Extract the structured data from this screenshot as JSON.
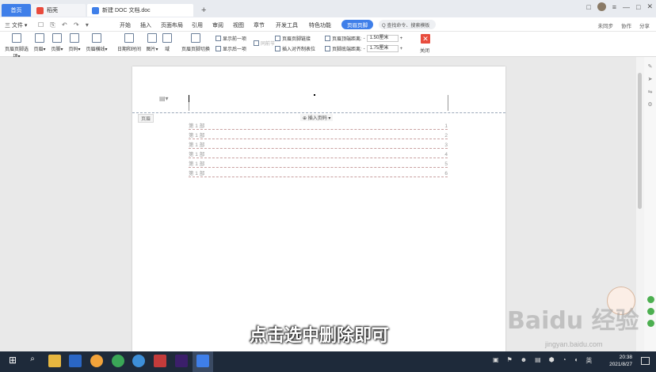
{
  "tabs": {
    "home": "首页",
    "wps": "稻壳",
    "doc": "新建 DOC 文档.doc",
    "add": "+"
  },
  "window": {
    "right_icons": [
      "□",
      "≡",
      "—",
      "□",
      "✕"
    ]
  },
  "menu": {
    "file": "三 文件 ▾",
    "quick_icons": "☐ ⎘ ↶ ↷ ▾",
    "items": [
      "开始",
      "插入",
      "页面布局",
      "引用",
      "审阅",
      "视图",
      "章节",
      "开发工具",
      "特色功能"
    ],
    "active": "页眉页脚",
    "search": "Q 查找命令、搜索模板",
    "right_links": [
      "未同步",
      "协作",
      "分享"
    ]
  },
  "ribbon": {
    "buttons": [
      "页眉页脚选项▾",
      "页眉▾",
      "页脚▾",
      "页码▾",
      "页眉横线▾",
      "日期和时间",
      "图片▾",
      "域",
      "页眉页脚切换"
    ],
    "checks": [
      "显示前一项",
      "显示后一项",
      "同前节"
    ],
    "checks2": [
      "页眉页脚链接",
      "插入对齐制表位"
    ],
    "spin1_label": "页眉顶端距离:",
    "spin1_value": "1.50厘米",
    "spin2_label": "页脚底端距离:",
    "spin2_value": "1.75厘米",
    "close": "关闭"
  },
  "page": {
    "header_tag": "页眉",
    "insert_page": "⊕ 插入页码 ▾",
    "toc": [
      {
        "label": "第 1 部",
        "page": "1"
      },
      {
        "label": "第 1 部",
        "page": "2"
      },
      {
        "label": "第 1 部",
        "page": "3"
      },
      {
        "label": "第 1 部",
        "page": "4"
      },
      {
        "label": "第 1 部",
        "page": "5"
      },
      {
        "label": "第 1 部",
        "page": "6"
      }
    ]
  },
  "overlay": {
    "subtitle": "点击选中删除即可",
    "watermark": "Baidu 经验",
    "watermark_url": "jingyan.baidu.com"
  },
  "taskbar": {
    "time": "20:38",
    "date": "2021/8/27",
    "lang": "英"
  }
}
